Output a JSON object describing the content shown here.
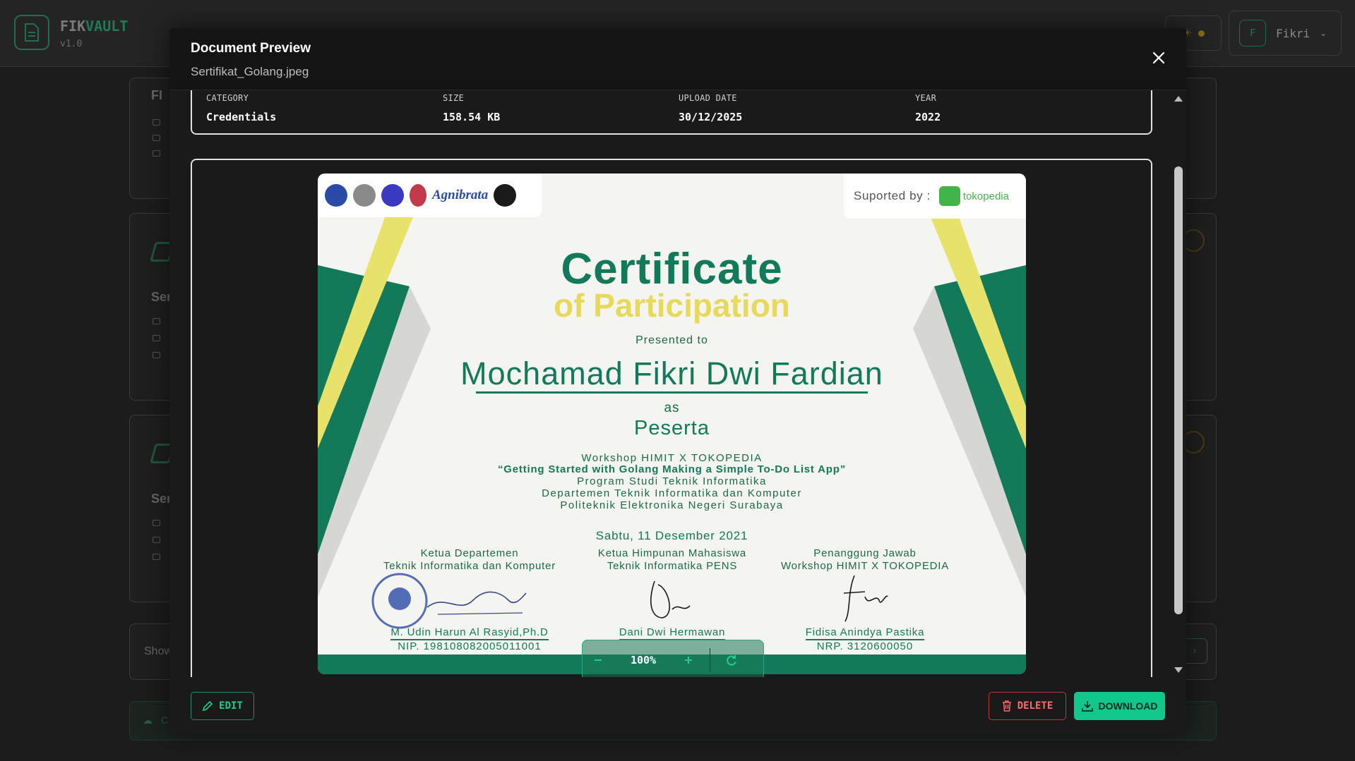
{
  "app": {
    "logo_prefix": "FIK",
    "logo_suffix": "VAULT",
    "version": "v1.0",
    "user_initial": "F",
    "user_name": "Fikri"
  },
  "background": {
    "card1_title": "FI",
    "card2_title": "Ser",
    "card3_title": "Ser",
    "show_label": "Show",
    "bottom_label": "C"
  },
  "modal": {
    "title": "Document Preview",
    "filename": "Sertifikat_Golang.jpeg",
    "meta": [
      {
        "label": "CATEGORY",
        "value": "Credentials"
      },
      {
        "label": "SIZE",
        "value": "158.54 KB"
      },
      {
        "label": "UPLOAD DATE",
        "value": "30/12/2025"
      },
      {
        "label": "YEAR",
        "value": "2022"
      }
    ],
    "zoom_level": "100%",
    "actions": {
      "edit": "EDIT",
      "delete": "DELETE",
      "download": "DOWNLOAD"
    }
  },
  "certificate": {
    "logo_text": "Agnibrata",
    "supported_by": "Suported by :",
    "sponsor": "tokopedia",
    "title_line1": "Certificate",
    "title_line2": "of Participation",
    "presented_to": "Presented to",
    "recipient": "Mochamad Fikri Dwi Fardian",
    "as": "as",
    "role": "Peserta",
    "workshop": "Workshop HIMIT X TOKOPEDIA",
    "topic": "“Getting Started with Golang Making a Simple To-Do List App”",
    "program": "Program Studi Teknik Informatika",
    "department": "Departemen Teknik Informatika dan Komputer",
    "institution": "Politeknik Elektronika Negeri Surabaya",
    "date": "Sabtu, 11 Desember 2021",
    "signatories": [
      {
        "role1": "Ketua Departemen",
        "role2": "Teknik Informatika dan Komputer",
        "name": "M. Udin Harun Al Rasyid,Ph.D",
        "id": "NIP. 198108082005011001"
      },
      {
        "role1": "Ketua Himpunan Mahasiswa",
        "role2": "Teknik Informatika PENS",
        "name": "Dani Dwi Hermawan",
        "id": ""
      },
      {
        "role1": "Penanggung Jawab",
        "role2": "Workshop HIMIT X TOKOPEDIA",
        "name": "Fidisa Anindya Pastika",
        "id": "NRP. 3120600050"
      }
    ]
  },
  "icons": {
    "close": "close-icon",
    "edit": "pencil-icon",
    "delete": "trash-icon",
    "download": "download-icon",
    "zoom_out": "minus-icon",
    "zoom_in": "plus-icon",
    "reset": "refresh-icon"
  },
  "colors": {
    "accent": "#10c88c",
    "danger": "#ff6a6a",
    "cert_green": "#127a5a",
    "cert_yellow": "#e8d95a"
  }
}
